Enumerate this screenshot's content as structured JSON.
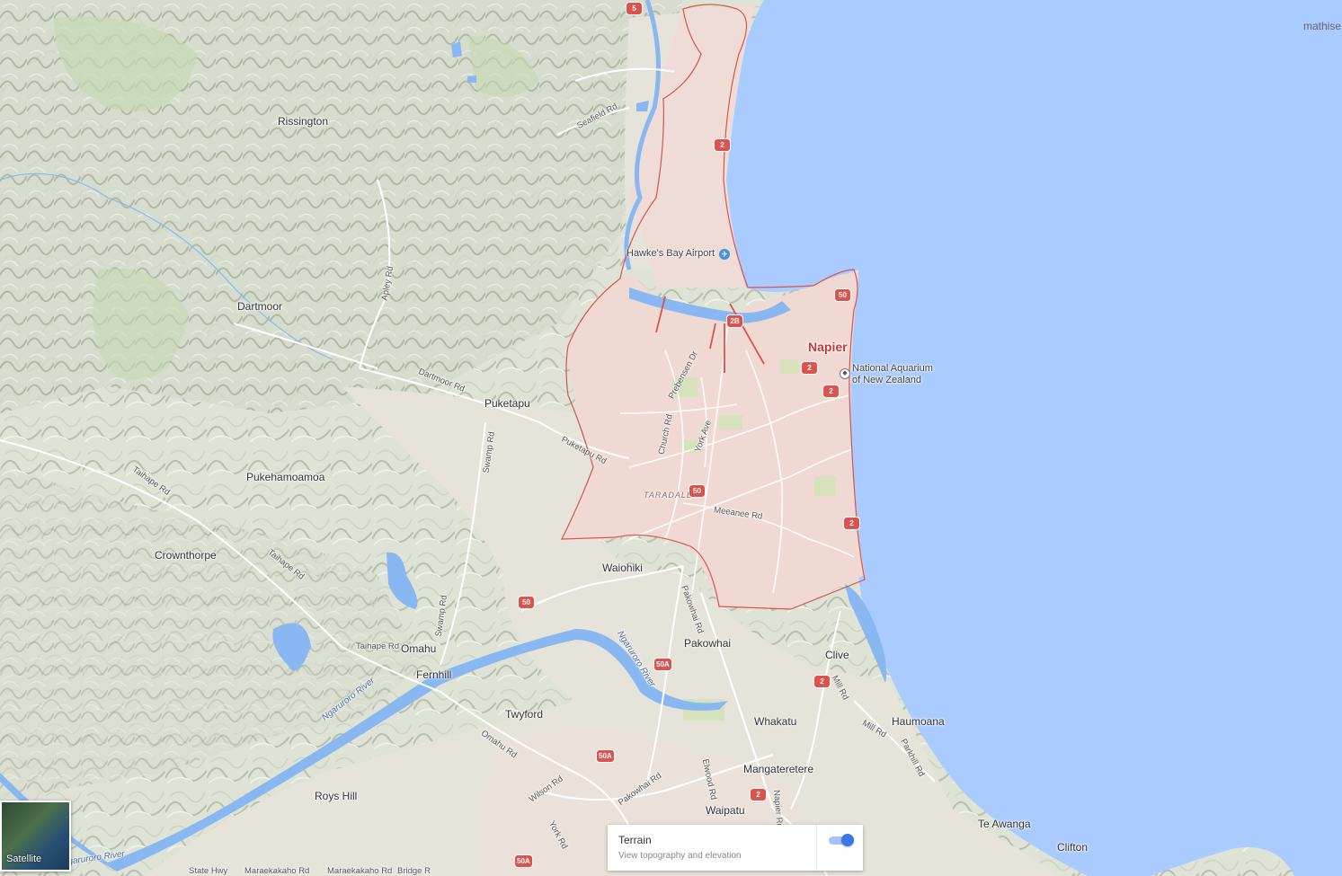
{
  "user_name": "mathise",
  "colors": {
    "water": "#aacbff",
    "land": "#dfe3d6",
    "urban": "#f1d9d3",
    "boundary": "#d9534f",
    "river": "#88b7f2",
    "highway_shield": "#d9534f",
    "toggle_on": "#3b78e7"
  },
  "places": {
    "rissington": "Rissington",
    "dartmoor": "Dartmoor",
    "puketapu": "Puketapu",
    "pukehamoamoa": "Pukehamoamoa",
    "crownthorpe": "Crownthorpe",
    "waiohiki": "Waiohiki",
    "omahu": "Omahu",
    "fernhill": "Fernhill",
    "pakowhai": "Pakowhai",
    "clive": "Clive",
    "twyford": "Twyford",
    "whakatu": "Whakatu",
    "haumoana": "Haumoana",
    "mangateretere": "Mangateretere",
    "roys_hill": "Roys Hill",
    "waipatu": "Waipatu",
    "te_awanga": "Te Awanga",
    "clifton": "Clifton",
    "napier": "Napier",
    "taradale": "TARADALE"
  },
  "pois": {
    "airport": "Hawke's Bay Airport",
    "aquarium_line1": "National Aquarium",
    "aquarium_line2": "of New Zealand"
  },
  "roads": {
    "seafield": "Seafield Rd",
    "dartmoor": "Dartmoor Rd",
    "puketapu": "Puketapu Rd",
    "swamp_upper": "Swamp Rd",
    "swamp_lower": "Swamp Rd",
    "taihape_1": "Taihape Rd",
    "taihape_2": "Taihape Rd",
    "taihape_3": "Taihape Rd",
    "apley": "Apley Rd",
    "church": "Church Rd",
    "york_ave": "York Ave",
    "meeanee": "Meeanee Rd",
    "pakowhai": "Pakowhai Rd",
    "pakowhai_lower": "Pakowhai Rd",
    "omahu_rd": "Omahu Rd",
    "wilson": "Wilson Rd",
    "york_rd": "York Rd",
    "elwood": "Elwood Rd",
    "napier_rd": "Napier Rd",
    "mill_1": "Mill Rd",
    "mill_2": "Mill Rd",
    "parkhill": "Parkhill Rd",
    "state_hwy": "State Hwy",
    "maraekakaho_1": "Maraekakaho Rd",
    "maraekakaho_2": "Maraekakaho Rd",
    "bridge": "Bridge R",
    "prebensen": "Prebensen Dr"
  },
  "rivers": {
    "ngaruroro_1": "Ngaruroro River",
    "ngaruroro_2": "Ngaruroro River",
    "ngaruroro_3": "Ngaruroro River"
  },
  "shields": {
    "s5": "5",
    "s2_a": "2",
    "s2b": "2B",
    "s50_a": "50",
    "s2_b": "2",
    "s2_c": "2",
    "s50_b": "50",
    "s2_d": "2",
    "s50_c": "50",
    "s50a_a": "50A",
    "s2_e": "2",
    "s50a_b": "50A",
    "s2_f": "2",
    "s50a_c": "50A"
  },
  "controls": {
    "satellite_label": "Satellite",
    "terrain_title": "Terrain",
    "terrain_desc": "View topography and elevation",
    "terrain_enabled": true
  }
}
